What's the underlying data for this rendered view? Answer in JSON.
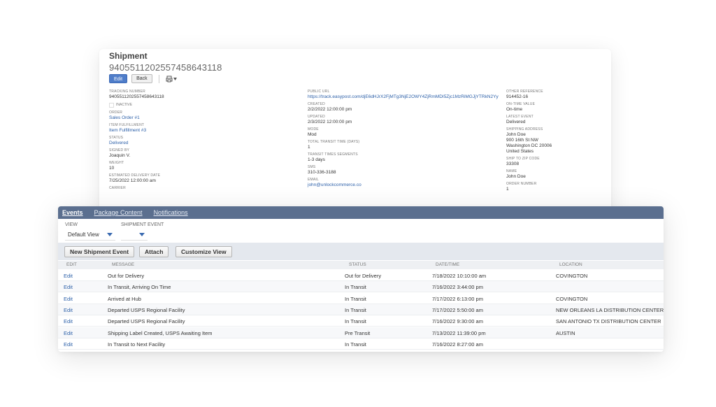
{
  "record": {
    "title": "Shipment",
    "number": "9405511202557458643118",
    "edit_label": "Edit",
    "back_label": "Back",
    "col1": {
      "tracking_number_label": "TRACKING NUMBER",
      "tracking_number": "9405511202557458643118",
      "inactive_label": "INACTIVE",
      "order_label": "ORDER",
      "order": "Sales Order #1",
      "item_fulfillment_label": "ITEM FULFILLMENT",
      "item_fulfillment": "Item Fulfillment #3",
      "status_label": "STATUS",
      "status": "Delivered",
      "signed_by_label": "SIGNED BY",
      "signed_by": "Joaquin V.",
      "weight_label": "WEIGHT",
      "weight": "10",
      "est_delivery_label": "ESTIMATED DELIVERY DATE",
      "est_delivery": "7/25/2022 12:00:00 am",
      "carrier_label": "CARRIER"
    },
    "col2": {
      "public_url_label": "PUBLIC URL",
      "public_url": "https://track.easypost.com/djE6dHJrX2FjMTg3NjE2OWY4ZjRmMDI5Zjc1MzRiMGJjYTRkN2Yy",
      "created_label": "CREATED",
      "created": "2/2/2022 12:00:00 pm",
      "updated_label": "UPDATED",
      "updated": "2/3/2022 12:00:00 pm",
      "mode_label": "MODE",
      "mode": "Mod",
      "total_transit_label": "TOTAL TRANSIT TIME (DAYS)",
      "total_transit": "1",
      "segments_label": "TRANSIT TIMES SEGMENTS",
      "segments": "1-3 days",
      "sms_label": "SMS",
      "sms": "310-336-3188",
      "email_label": "EMAIL",
      "email": "john@unlockcommerce.co"
    },
    "col3": {
      "other_ref_label": "OTHER REFERENCE",
      "other_ref": "914452-16",
      "on_time_label": "ON-TIME VALUE",
      "on_time": "On-time",
      "latest_event_label": "LATEST EVENT",
      "latest_event": "Delivered",
      "ship_addr_label": "SHIPPING ADDRESS",
      "ship_addr_1": "John Doe",
      "ship_addr_2": "900 16th St NW",
      "ship_addr_3": "Washington DC 20006",
      "ship_addr_4": "United States",
      "ship_zip_label": "SHIP TO ZIP CODE",
      "ship_zip": "33308",
      "name_label": "NAME",
      "name": "John Doe",
      "order_number_label": "ORDER NUMBER",
      "order_number": "1"
    }
  },
  "sublist": {
    "tabs": [
      "Events",
      "Package Content",
      "Notifications"
    ],
    "view_label": "VIEW",
    "view_value": "Default View",
    "event_label": "SHIPMENT EVENT",
    "event_value": "",
    "buttons": [
      "New Shipment Event",
      "Attach",
      "Customize View"
    ],
    "columns": [
      "EDIT",
      "MESSAGE",
      "STATUS",
      "DATE/TIME",
      "LOCATION"
    ],
    "rows": [
      {
        "edit": "Edit",
        "message": "Out for Delivery",
        "status": "Out for Delivery",
        "datetime": "7/18/2022 10:10:00 am",
        "location": "COVINGTON"
      },
      {
        "edit": "Edit",
        "message": "In Transit, Arriving On Time",
        "status": "In Transit",
        "datetime": "7/16/2022 3:44:00 pm",
        "location": ""
      },
      {
        "edit": "Edit",
        "message": "Arrived at Hub",
        "status": "In Transit",
        "datetime": "7/17/2022 6:13:00 pm",
        "location": "COVINGTON"
      },
      {
        "edit": "Edit",
        "message": "Departed USPS Regional Facility",
        "status": "In Transit",
        "datetime": "7/17/2022 5:50:00 am",
        "location": "NEW ORLEANS LA DISTRIBUTION CENTER"
      },
      {
        "edit": "Edit",
        "message": "Departed USPS Regional Facility",
        "status": "In Transit",
        "datetime": "7/16/2022 9:30:00 am",
        "location": "SAN ANTONIO TX DISTRIBUTION CENTER"
      },
      {
        "edit": "Edit",
        "message": "Shipping Label Created, USPS Awaiting Item",
        "status": "Pre Transit",
        "datetime": "7/13/2022 11:39:00 pm",
        "location": "AUSTIN"
      },
      {
        "edit": "Edit",
        "message": "In Transit to Next Facility",
        "status": "In Transit",
        "datetime": "7/16/2022 8:27:00 am",
        "location": ""
      }
    ]
  }
}
